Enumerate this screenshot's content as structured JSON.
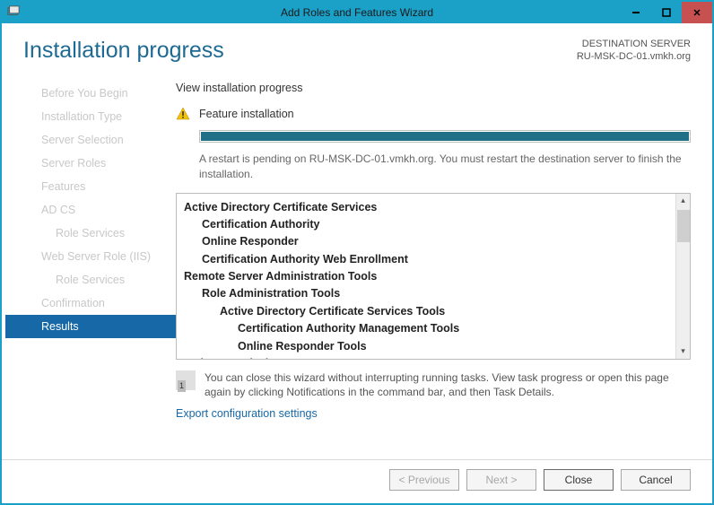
{
  "window": {
    "title": "Add Roles and Features Wizard"
  },
  "header": {
    "page_title": "Installation progress",
    "dest_label": "DESTINATION SERVER",
    "dest_value": "RU-MSK-DC-01.vmkh.org"
  },
  "sidebar": {
    "items": [
      {
        "label": "Before You Begin",
        "indent": false,
        "active": false
      },
      {
        "label": "Installation Type",
        "indent": false,
        "active": false
      },
      {
        "label": "Server Selection",
        "indent": false,
        "active": false
      },
      {
        "label": "Server Roles",
        "indent": false,
        "active": false
      },
      {
        "label": "Features",
        "indent": false,
        "active": false
      },
      {
        "label": "AD CS",
        "indent": false,
        "active": false
      },
      {
        "label": "Role Services",
        "indent": true,
        "active": false
      },
      {
        "label": "Web Server Role (IIS)",
        "indent": false,
        "active": false
      },
      {
        "label": "Role Services",
        "indent": true,
        "active": false
      },
      {
        "label": "Confirmation",
        "indent": false,
        "active": false
      },
      {
        "label": "Results",
        "indent": false,
        "active": true
      }
    ]
  },
  "main": {
    "section_label": "View installation progress",
    "feature_label": "Feature installation",
    "restart_note": "A restart is pending on RU-MSK-DC-01.vmkh.org. You must restart the destination server to finish the installation.",
    "tree": [
      {
        "text": "Active Directory Certificate Services",
        "level": 0
      },
      {
        "text": "Certification Authority",
        "level": 1
      },
      {
        "text": "Online Responder",
        "level": 1
      },
      {
        "text": "Certification Authority Web Enrollment",
        "level": 1
      },
      {
        "text": "Remote Server Administration Tools",
        "level": 0
      },
      {
        "text": "Role Administration Tools",
        "level": 1
      },
      {
        "text": "Active Directory Certificate Services Tools",
        "level": 2
      },
      {
        "text": "Certification Authority Management Tools",
        "level": 3
      },
      {
        "text": "Online Responder Tools",
        "level": 3
      },
      {
        "text": "Web Server (IIS)",
        "level": 0
      }
    ],
    "info_text": "You can close this wizard without interrupting running tasks. View task progress or open this page again by clicking Notifications in the command bar, and then Task Details.",
    "export_link": "Export configuration settings"
  },
  "footer": {
    "previous": "< Previous",
    "next": "Next >",
    "close": "Close",
    "cancel": "Cancel"
  }
}
